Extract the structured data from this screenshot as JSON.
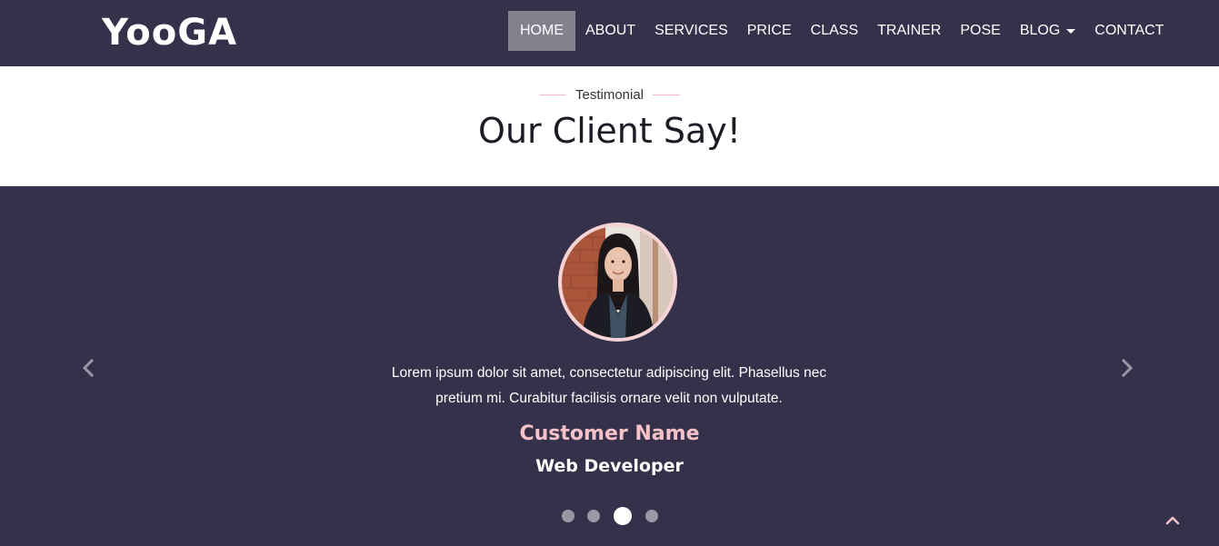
{
  "brand": "YooGA",
  "nav": {
    "items": [
      {
        "label": "HOME",
        "active": true
      },
      {
        "label": "ABOUT"
      },
      {
        "label": "SERVICES"
      },
      {
        "label": "PRICE"
      },
      {
        "label": "CLASS"
      },
      {
        "label": "TRAINER"
      },
      {
        "label": "POSE"
      },
      {
        "label": "BLOG",
        "dropdown": true
      },
      {
        "label": "CONTACT"
      }
    ]
  },
  "section": {
    "eyebrow": "Testimonial",
    "title": "Our Client Say!"
  },
  "testimonial": {
    "quote_line1": "Lorem ipsum dolor sit amet, consectetur adipiscing elit. Phasellus nec",
    "quote_line2": "pretium mi. Curabitur facilisis ornare velit non vulputate.",
    "name": "Customer Name",
    "role": "Web Developer",
    "avatar_icon": "client-photo",
    "prev_icon": "chevron-left-icon",
    "next_icon": "chevron-right-icon",
    "slide_count": 4,
    "active_slide": 3
  },
  "back_to_top_icon": "chevron-up-icon",
  "colors": {
    "navbar_bg": "#36314a",
    "accent_pink": "#f6c2c7",
    "active_nav_bg": "#85808e"
  }
}
